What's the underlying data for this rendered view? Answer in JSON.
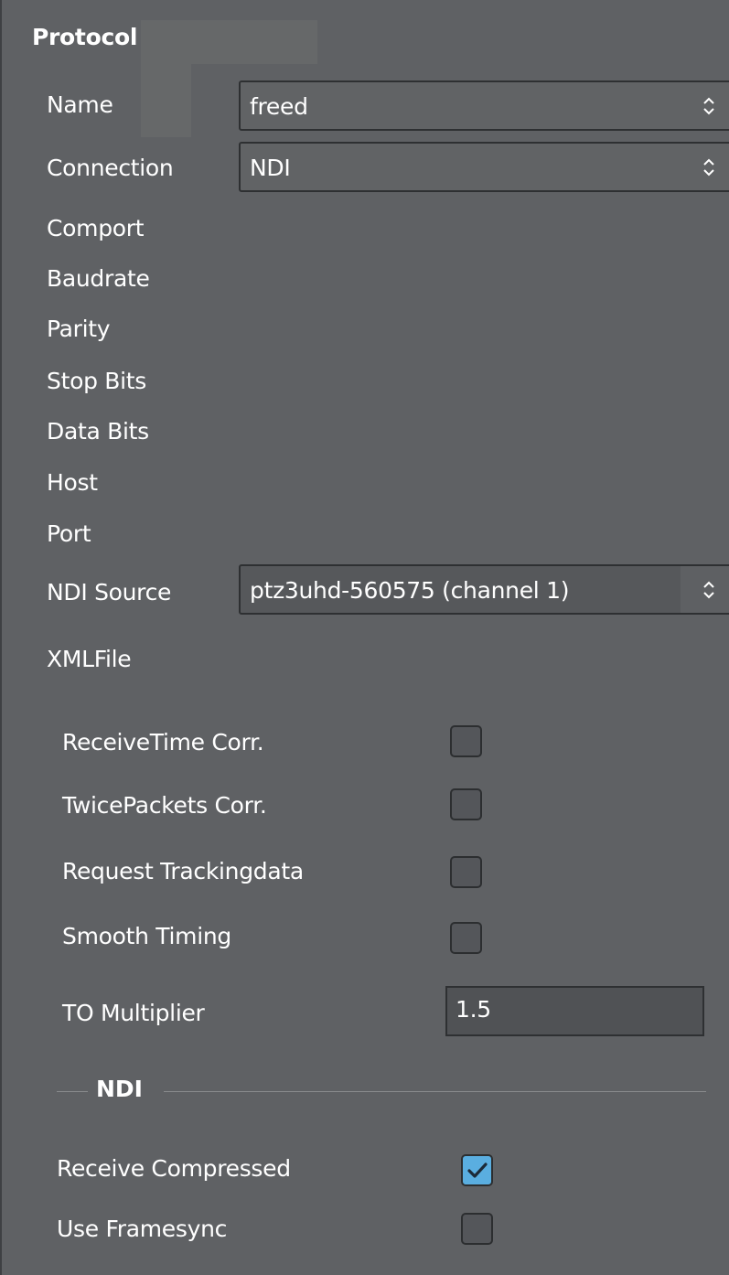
{
  "protocol": {
    "title": "Protocol",
    "name_label": "Name",
    "name_value": "freed",
    "connection_label": "Connection",
    "connection_value": "NDI",
    "comport_label": "Comport",
    "baudrate_label": "Baudrate",
    "parity_label": "Parity",
    "stopbits_label": "Stop Bits",
    "databits_label": "Data Bits",
    "host_label": "Host",
    "port_label": "Port",
    "ndisource_label": "NDI Source",
    "ndisource_value": "ptz3uhd-560575 (channel 1)",
    "xmlfile_label": "XMLFile"
  },
  "options": {
    "receivetime_label": "ReceiveTime Corr.",
    "receivetime_checked": false,
    "twicepackets_label": "TwicePackets Corr.",
    "twicepackets_checked": false,
    "request_label": "Request Trackingdata",
    "request_checked": false,
    "smooth_label": "Smooth Timing",
    "smooth_checked": false,
    "tomultiplier_label": "TO Multiplier",
    "tomultiplier_value": "1.5"
  },
  "ndi": {
    "title": "NDI",
    "receive_compressed_label": "Receive Compressed",
    "receive_compressed_checked": true,
    "use_framesync_label": "Use Framesync",
    "use_framesync_checked": false
  },
  "colors": {
    "panel_bg": "#5f6164",
    "check_accent": "#5aaee0"
  },
  "icons": {
    "combo_arrow": "updown-chevron-icon",
    "check": "checkmark-icon"
  }
}
